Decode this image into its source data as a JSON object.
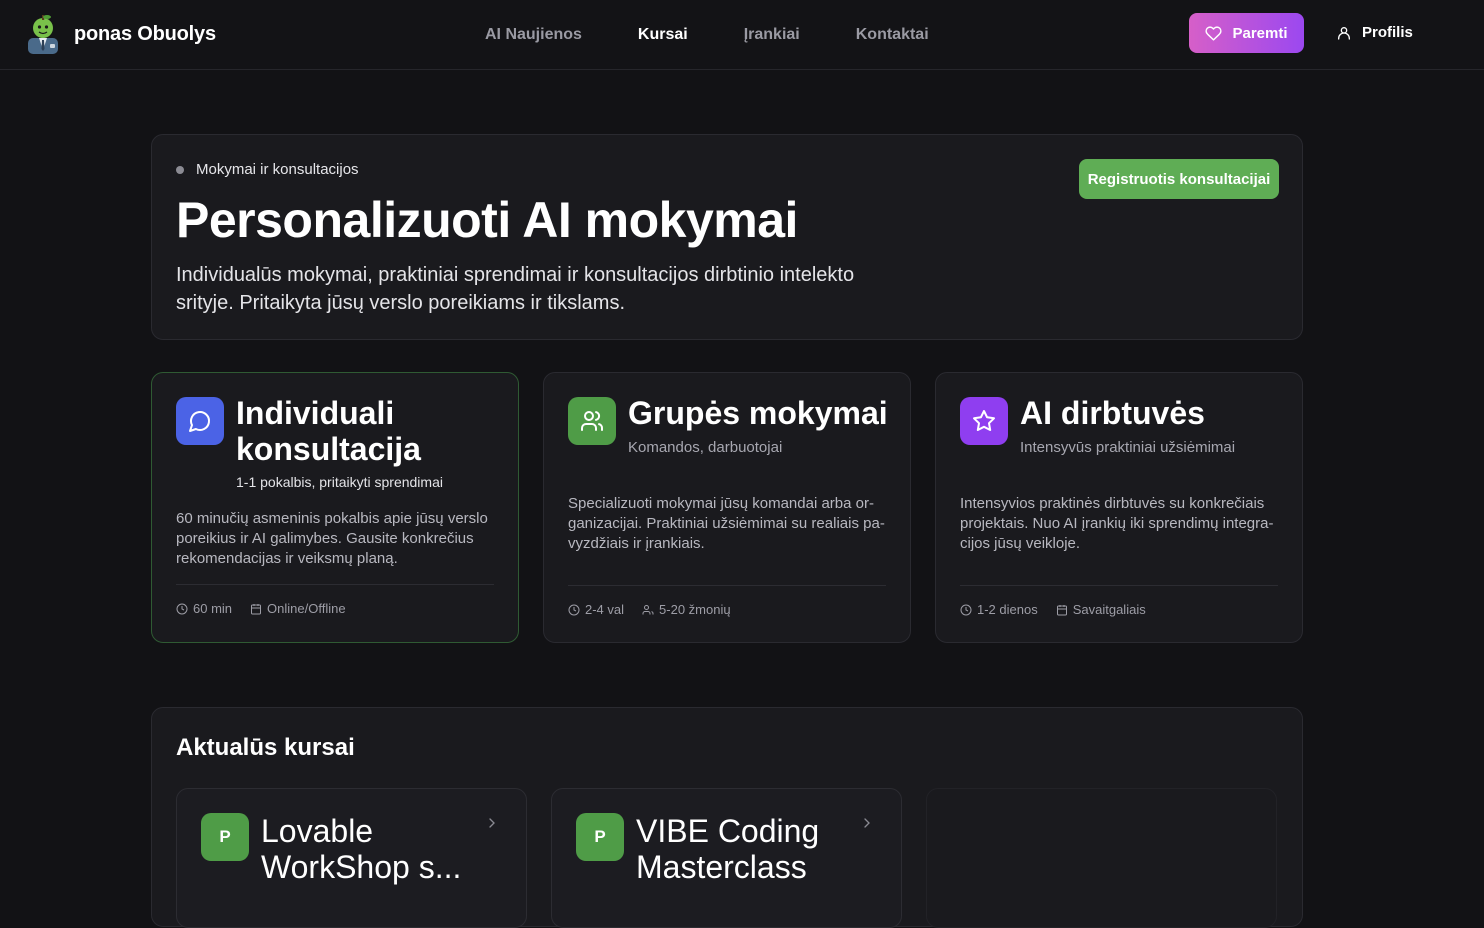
{
  "header": {
    "brand": "ponas Obuolys",
    "nav": [
      {
        "label": "AI Naujienos",
        "active": false
      },
      {
        "label": "Kursai",
        "active": true
      },
      {
        "label": "Įrankiai",
        "active": false
      },
      {
        "label": "Kontaktai",
        "active": false
      }
    ],
    "support_label": "Paremti",
    "support_icon": "heart-icon",
    "profile_label": "Profilis",
    "profile_icon": "user-icon"
  },
  "hero": {
    "eyebrow": "Mokymai ir konsultacijos",
    "title": "Personalizuoti AI mokymai",
    "description": "Individualūs mokymai, praktiniai sprendimai ir konsultacijos dirbtinio intelekto srityje. Pritaikyta jūsų verslo poreikiams ir tikslams.",
    "cta": "Registruotis konsultacijai"
  },
  "services": [
    {
      "title": "Individuali konsultacija",
      "subtitle": "1-1 pokalbis, pritaikyti sprendimai",
      "description": "60 minučių asmeninis pokalbis apie jūsų verslo poreikius ir AI galimybes. Gausite konkrečius rekomendacijas ir veiksmų planą.",
      "meta": [
        "60 min",
        "Online/Offline"
      ],
      "icon": "chat-bubble-icon",
      "color": "#4b63e6"
    },
    {
      "title": "Grupės mokymai",
      "subtitle": "Komandos, darbuotojai",
      "description": "Specializuoti mokymai jūsų komandai arba or­ganizacijai. Praktiniai užsiėmimai su realiais pa­vyzdžiais ir įrankiais.",
      "meta": [
        "2-4 val",
        "5-20 žmonių"
      ],
      "icon": "users-icon",
      "color": "#4f9c47"
    },
    {
      "title": "AI dirbtuvės",
      "subtitle": "Intensyvūs praktiniai užsiėmimai",
      "description": "Intensyvios praktinės dirbtuvės su konkrečiais projektais. Nuo AI įrankių iki sprendimų integra­cijos jūsų veikloje.",
      "meta": [
        "1-2 dienos",
        "Savaitgaliais"
      ],
      "icon": "star-icon",
      "color": "#8f3ef0"
    }
  ],
  "courses": {
    "title": "Aktualūs kursai",
    "items": [
      {
        "badge": "P",
        "title": "Lovable WorkShop s..."
      },
      {
        "badge": "P",
        "title": "VIBE Coding Masterclass"
      }
    ]
  }
}
